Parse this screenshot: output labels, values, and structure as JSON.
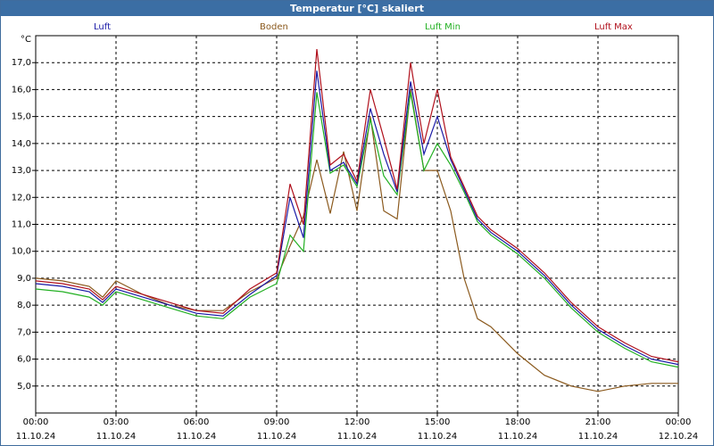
{
  "window": {
    "title": "Temperatur [°C] skaliert"
  },
  "colors": {
    "titlebar": "#3b6ea4",
    "Luft": "#1a1aa6",
    "Boden": "#8b5a1e",
    "LuftMin": "#22b022",
    "LuftMax": "#b0101c"
  },
  "chart_data": {
    "type": "line",
    "title": "Temperatur [°C] skaliert",
    "ylabel": "°C",
    "ylim": [
      4.0,
      18.0
    ],
    "yticks": [
      "5,0",
      "6,0",
      "7,0",
      "8,0",
      "9,0",
      "10,0",
      "11,0",
      "12,0",
      "13,0",
      "14,0",
      "15,0",
      "16,0",
      "17,0"
    ],
    "xticks": [
      {
        "time": "00:00",
        "date": "11.10.24"
      },
      {
        "time": "03:00",
        "date": "11.10.24"
      },
      {
        "time": "06:00",
        "date": "11.10.24"
      },
      {
        "time": "09:00",
        "date": "11.10.24"
      },
      {
        "time": "12:00",
        "date": "11.10.24"
      },
      {
        "time": "15:00",
        "date": "11.10.24"
      },
      {
        "time": "18:00",
        "date": "11.10.24"
      },
      {
        "time": "21:00",
        "date": "11.10.24"
      },
      {
        "time": "00:00",
        "date": "12.10.24"
      }
    ],
    "x_hours": [
      0,
      1,
      2,
      2.5,
      3,
      4,
      5,
      6,
      7,
      8,
      9,
      9.5,
      10,
      10.5,
      11,
      11.5,
      12,
      12.5,
      13,
      13.5,
      14,
      14.5,
      15,
      15.5,
      16,
      16.5,
      17,
      18,
      19,
      20,
      21,
      22,
      23,
      24
    ],
    "grid": true,
    "series": [
      {
        "name": "Luft",
        "values": [
          8.8,
          8.7,
          8.5,
          8.1,
          8.6,
          8.3,
          8.0,
          7.7,
          7.6,
          8.4,
          9.1,
          12.0,
          10.5,
          16.7,
          13.0,
          13.3,
          12.5,
          15.3,
          13.6,
          12.2,
          16.3,
          13.6,
          15.0,
          13.4,
          12.3,
          11.2,
          10.7,
          10.0,
          9.1,
          8.0,
          7.1,
          6.5,
          6.0,
          5.8
        ]
      },
      {
        "name": "Boden",
        "values": [
          9.0,
          8.9,
          8.7,
          8.3,
          8.9,
          8.4,
          8.0,
          7.8,
          7.8,
          8.5,
          9.0,
          10.2,
          11.3,
          13.4,
          11.4,
          13.7,
          11.5,
          15.0,
          11.5,
          11.2,
          16.0,
          13.0,
          13.0,
          11.5,
          9.0,
          7.5,
          7.2,
          6.2,
          5.4,
          5.0,
          4.8,
          5.0,
          5.1,
          5.1
        ]
      },
      {
        "name": "Luft Min",
        "values": [
          8.6,
          8.5,
          8.3,
          8.0,
          8.5,
          8.2,
          7.9,
          7.6,
          7.5,
          8.3,
          8.8,
          10.6,
          10.0,
          15.9,
          12.9,
          13.2,
          12.4,
          14.9,
          12.8,
          12.1,
          15.9,
          13.0,
          14.0,
          13.2,
          12.2,
          11.1,
          10.6,
          9.9,
          9.0,
          7.9,
          7.0,
          6.4,
          5.9,
          5.7
        ]
      },
      {
        "name": "Luft Max",
        "values": [
          8.9,
          8.8,
          8.6,
          8.2,
          8.7,
          8.4,
          8.1,
          7.8,
          7.7,
          8.6,
          9.2,
          12.5,
          11.0,
          17.5,
          13.2,
          13.6,
          12.6,
          16.0,
          14.2,
          12.3,
          17.0,
          14.0,
          16.0,
          13.5,
          12.4,
          11.3,
          10.8,
          10.1,
          9.2,
          8.1,
          7.2,
          6.6,
          6.1,
          5.9
        ]
      }
    ]
  }
}
